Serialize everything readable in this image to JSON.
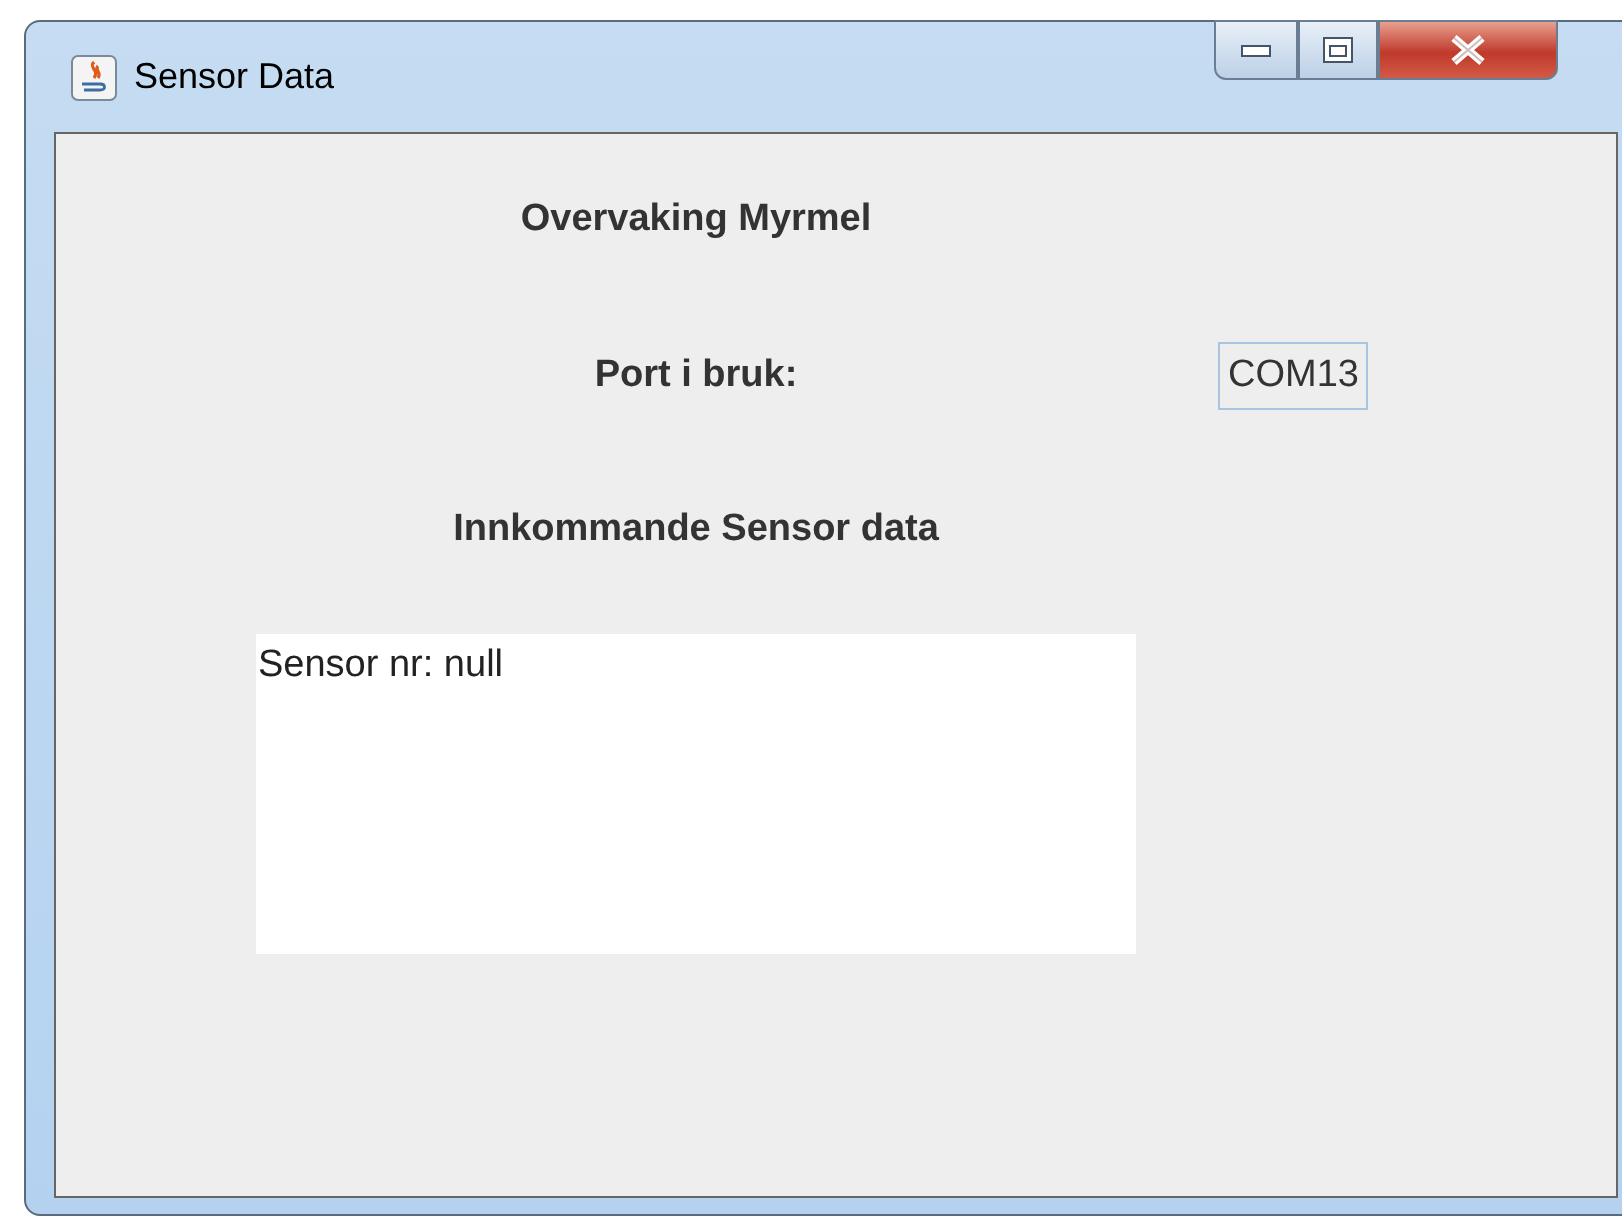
{
  "window": {
    "title": "Sensor Data"
  },
  "heading": "Overvaking Myrmel",
  "port": {
    "label": "Port i bruk:",
    "value": "COM13"
  },
  "incoming": {
    "label": "Innkommande Sensor data",
    "text": "Sensor nr: null"
  }
}
